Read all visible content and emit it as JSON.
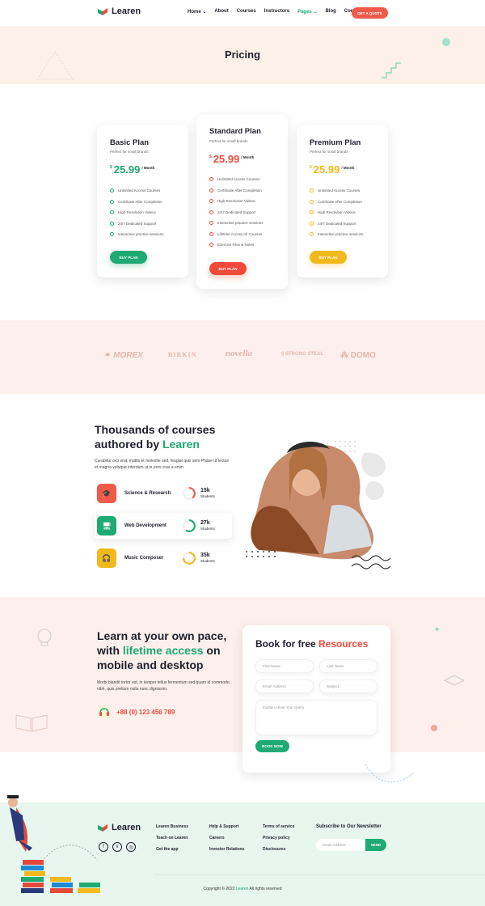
{
  "header": {
    "logo_text": "Learen",
    "nav": [
      "Home",
      "About",
      "Courses",
      "Instructors",
      "Pages",
      "Blog",
      "Contact"
    ],
    "quote_button": "GET A QUOTE"
  },
  "banner": {
    "title": "Pricing"
  },
  "plans": [
    {
      "name": "Basic Plan",
      "subtitle": "Perfect for small brands",
      "currency": "$",
      "price": "25.99",
      "period": "/ Month",
      "color": "#1eaa72",
      "button": "BUY PLAN",
      "features": [
        "Unlimited Access Courses",
        "Certificate After Completion",
        "High Resolution Videos",
        "24/7 Dedicated Support",
        "Interactive practice sessions"
      ]
    },
    {
      "name": "Standard Plan",
      "subtitle": "Perfect for small brands",
      "currency": "$",
      "price": "25.99",
      "period": "/ Month",
      "color": "#ef4a3a",
      "button": "BUY PLAN",
      "features": [
        "Unlimited Access Courses",
        "Certificate After Completion",
        "High Resolution Videos",
        "24/7 Dedicated Support",
        "Interactive practice sessions",
        "Lifetime Access All Courses",
        "Exercise Files & Notes"
      ]
    },
    {
      "name": "Premium Plan",
      "subtitle": "Perfect for small brands",
      "currency": "$",
      "price": "25.99",
      "period": "/ Month",
      "color": "#f2b91c",
      "button": "BUY PLAN",
      "features": [
        "Unlimited Access Courses",
        "Certificate After Completion",
        "High Resolution Videos",
        "24/7 Dedicated Support",
        "Interactive practice sessions"
      ]
    }
  ],
  "brands": [
    "MOREX",
    "BIRKIN",
    "novella",
    "STRONG STEAL",
    "DOMO"
  ],
  "courses": {
    "title_line1": "Thousands of courses",
    "title_line2_prefix": "authored by ",
    "title_line2_highlight": "Learen",
    "description": "Curabitur orci erat, mattis et molestie sed, feugiat quis sem Phase ut lectus et magna volutpat interdum ut in eros cras a enim.",
    "items": [
      {
        "label": "Science & Research",
        "count": "15k",
        "unit": "Students",
        "color": "#ef5a4a",
        "progress": 0.4
      },
      {
        "label": "Web Development",
        "count": "27k",
        "unit": "Students",
        "color": "#1eaa72",
        "progress": 0.6
      },
      {
        "label": "Music Composer",
        "count": "35k",
        "unit": "Students",
        "color": "#f2b91c",
        "progress": 0.75
      }
    ]
  },
  "learn": {
    "line1": "Learn at your own pace,",
    "line2_prefix": "with ",
    "line2_highlight": "lifetime access",
    "line2_suffix": " on",
    "line3": "mobile and desktop",
    "description": "Morbi blandit tortor est, in tempor tellus fermentum sed quam id commodo nibh, quis pretium nulla nunc dignissim.",
    "phone": "+88 (0) 123 456 789"
  },
  "form": {
    "title_prefix": "Book for free ",
    "title_highlight": "Resources",
    "first_name": "First Name",
    "last_name": "Last Name",
    "email": "Email Address",
    "subject": "Subject",
    "message": "Explain About Your Query",
    "button": "BOOK NOW"
  },
  "footer": {
    "logo_text": "Learen",
    "col1": [
      "Learen Business",
      "Teach on Learen",
      "Get the app"
    ],
    "col2": [
      "Help & Support",
      "Careers",
      "Investor Relations"
    ],
    "col3": [
      "Terms of service",
      "Privacy policy",
      "Disclosures"
    ],
    "newsletter_title": "Subscribe to Our Newsletter",
    "newsletter_placeholder": "Email Address",
    "newsletter_button": "SEND",
    "copyright_prefix": "Copyright © 2022 ",
    "copyright_brand": "Learen",
    "copyright_suffix": " All rights reserved"
  }
}
